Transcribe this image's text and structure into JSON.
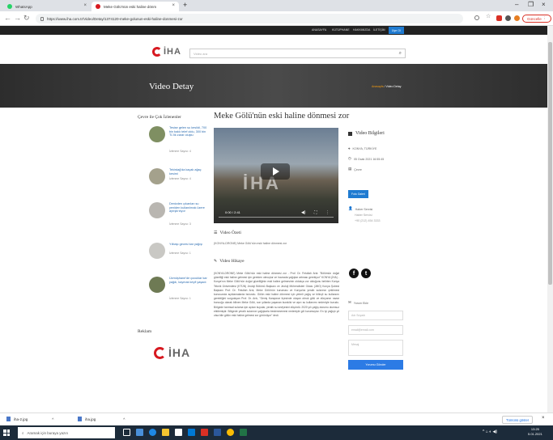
{
  "browser": {
    "tabs": [
      {
        "title": "WhatsApp",
        "icon": "whatsapp-icon",
        "color": "#25d366"
      },
      {
        "title": "Meke Gölü'nün eski haline dönm",
        "icon": "iha-favicon-icon",
        "color": "#d71920"
      }
    ],
    "url": "https://www.iha.com.tr/Video/Detay/1374120-meke-golunun-eski-haline-donmesi-zor",
    "update_label": "Güncelle"
  },
  "site": {
    "topnav": [
      "ANASAYFA",
      "KÜTÜPHANE",
      "HAKKIMIZDA",
      "İLETİŞİM"
    ],
    "login_label": "Üye Ol",
    "logo": "İHA",
    "search_placeholder": "Video ara",
    "hero_title": "Video Detay",
    "crumb_home": "Anasayfa",
    "crumb_current": "Video Detay"
  },
  "sidebar": {
    "popular_title": "Çevre ile Çok İzlenenler",
    "items": [
      {
        "title": "Tesise gelen su kesildi, 700 bin balık telef oldu, 300 bin TL'lik zarar oluştu",
        "views": "İzlenme Sayısı: 4"
      },
      {
        "title": "Tekirdağ'da kaçak ağaç kesimi",
        "views": "İzlenme Sayısı: 4"
      },
      {
        "title": "Denizden çıkarılan su yeniden kullanılmak üzere ayrıştırılıyor",
        "views": "İzlenme Sayısı: 3"
      },
      {
        "title": "Yılbaşı gecesi kar yağışı",
        "views": "İzlenme Sayısı: 1"
      },
      {
        "title": "Üzmüşhane'de çocuklar kar yağdı, kaymak keyfi yaşadı",
        "views": "İzlenme Sayısı: 1"
      }
    ],
    "ads_title": "Reklam",
    "ad_logo": "İHA"
  },
  "article": {
    "headline": "Meke Gölü'nün eski haline dönmesi zor",
    "video_time": "0:00 / 2:41",
    "summary_title": "Video Özeti",
    "summary_text": "(KONYA-DRONE) Meke Gölü'nün eski haline dönmesi zor",
    "story_title": "Video Hikaye",
    "story_text": "(KONYA-DRONE) Meke Gölü'nün eski haline dönmesi zor - Prof. Dr. Fetullah Arık: \"Bölümün doğal güzelliği eski haline gelmesi için gereken olmuştur ve havzada yağışlar artması gerekiyor\" KONYA (İHA) - Konya'nın Meke Gölü'nün doğal güzelliğinin eski haline gelmesinin oldukça zor olduğunu belirten Konya Teknik Üniversitesi (KTÜN) Jeoloji Bölümü Başkanı ve Jeoloji Mühendisleri Odası (JMO) Konya Şubesi Başkanı Prof. Dr. Fetullah Arık, Meke Gölü'nün kuruması ve Konya'da yeraltı sularının çekilmesi konusunda açıklamalarda bulundu. Gölün eski haline dönmesi için yeterli yağış ve bilinçli su kullanımı gerektiğini vurgulayan Prof. Dr. Arık, \"Geniş Karapınar ilçesinde oluşan obruk gölü ve dünyanın nazar boncuğu olarak bilinen Meke Gölü, son yıllarda yaşanan kuraklık ve aşırı su kullanımı nedeniyle kurudu. Bölgede tarımsal sulama için açılan kuyular, yeraltı su seviyesini düşürdü. 2020 yılı yağış durumu olumsuz etkilemiştir. Bölgede yeraltı sularının yağışlarla beslenmemesi nedeniyle göl kurumuştur. En iyi yağışlı yıl olsa bile gölün eski haline gelmesi zor görünüyor\" dedi."
  },
  "info": {
    "title": "Video Bilgileri",
    "location": "KONYA, TÜRKİYE",
    "date": "05 Ocak 2021 16:55:45",
    "category": "Çevre",
    "photo_btn": "Foto Galeri",
    "contact_name": "Haber Servisi",
    "contact_role": "Haber Servisi",
    "contact_phone": "+90 (212) 454 3333"
  },
  "comment": {
    "title": "Yorum Ekle",
    "name_ph": "Adı Soyadı",
    "email_ph": "email@email.com",
    "msg_ph": "Mesaj",
    "submit": "Yorumu Gönder"
  },
  "downloads": {
    "files": [
      "iha-2.jpg",
      "iha.jpg"
    ],
    "show_all": "Tümünü göster"
  },
  "taskbar": {
    "search_placeholder": "Aramak için buraya yazın",
    "time": "13:25",
    "date": "5.01.2021"
  }
}
